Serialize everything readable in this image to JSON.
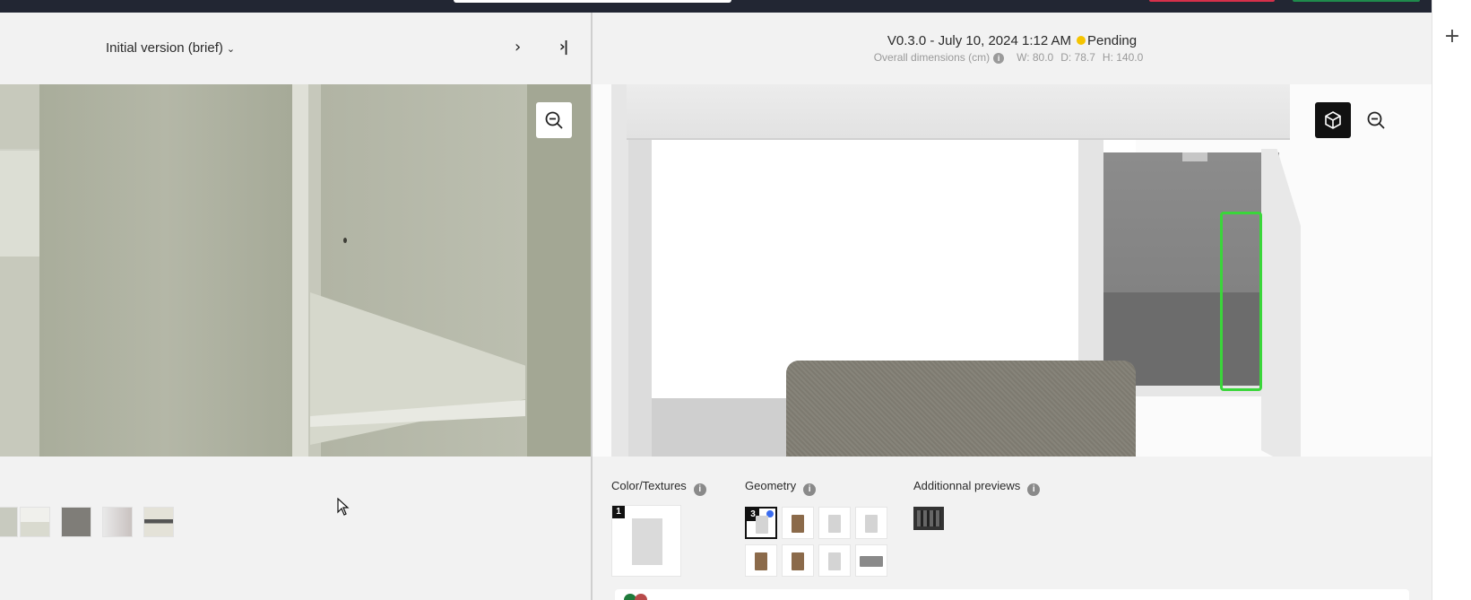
{
  "top_bar": {},
  "left_panel": {
    "version_select": "Initial version (brief)",
    "nav_next": "›",
    "nav_last": "⇥",
    "thumbnails": [
      "photo-1",
      "photo-2",
      "photo-3",
      "photo-4",
      "photo-5"
    ]
  },
  "right_panel": {
    "version": "V0.3.0 - July 10, 2024 1:12 AM",
    "status": "Pending",
    "status_color": "#f5c400",
    "dimensions_label": "Overall dimensions (cm)",
    "dims": {
      "w": "W: 80.0",
      "d": "D: 78.7",
      "h": "H: 140.0"
    },
    "sections": {
      "color_textures": {
        "label": "Color/Textures",
        "badge": "1"
      },
      "geometry": {
        "label": "Geometry",
        "badge": "3",
        "thumb_count": 8
      },
      "additional_previews": {
        "label": "Additionnal previews"
      }
    },
    "info_glyph": "i",
    "highlight_color": "#3ad63a"
  },
  "rail": {
    "plus": "+"
  },
  "colors": {
    "accent": "#111111",
    "selected_dot": "#3a6cf0",
    "topbar": "#222633"
  }
}
